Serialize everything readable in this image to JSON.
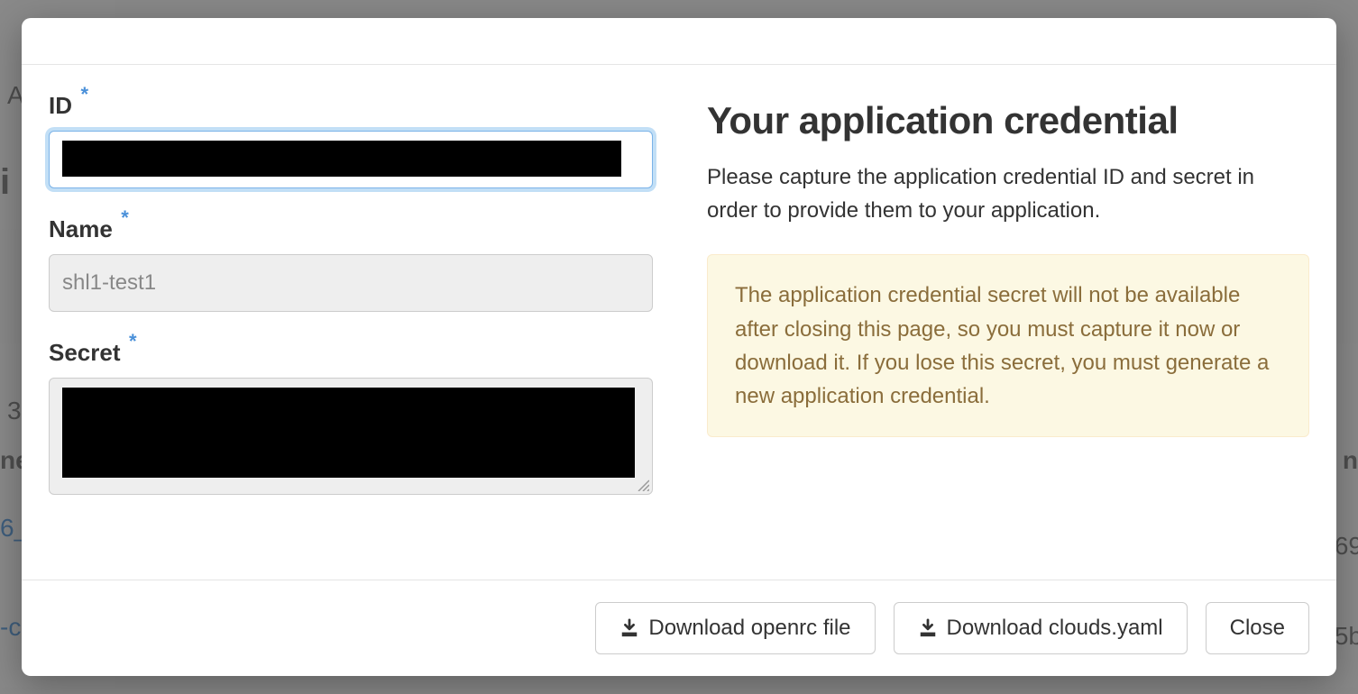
{
  "background": {
    "text1": "A",
    "text2": "i",
    "text3": "3",
    "text4": "ne",
    "text5": "6_",
    "text6": "-c",
    "text7": "n",
    "text8": "69",
    "text9": "5b"
  },
  "form": {
    "id_label": "ID",
    "id_value": "",
    "name_label": "Name",
    "name_value": "shl1-test1",
    "secret_label": "Secret",
    "secret_value": ""
  },
  "info": {
    "title": "Your application credential",
    "description": "Please capture the application credential ID and secret in order to provide them to your application.",
    "warning": "The application credential secret will not be available after closing this page, so you must capture it now or download it. If you lose this secret, you must generate a new application credential."
  },
  "footer": {
    "download_openrc": "Download openrc file",
    "download_clouds": "Download clouds.yaml",
    "close": "Close"
  }
}
